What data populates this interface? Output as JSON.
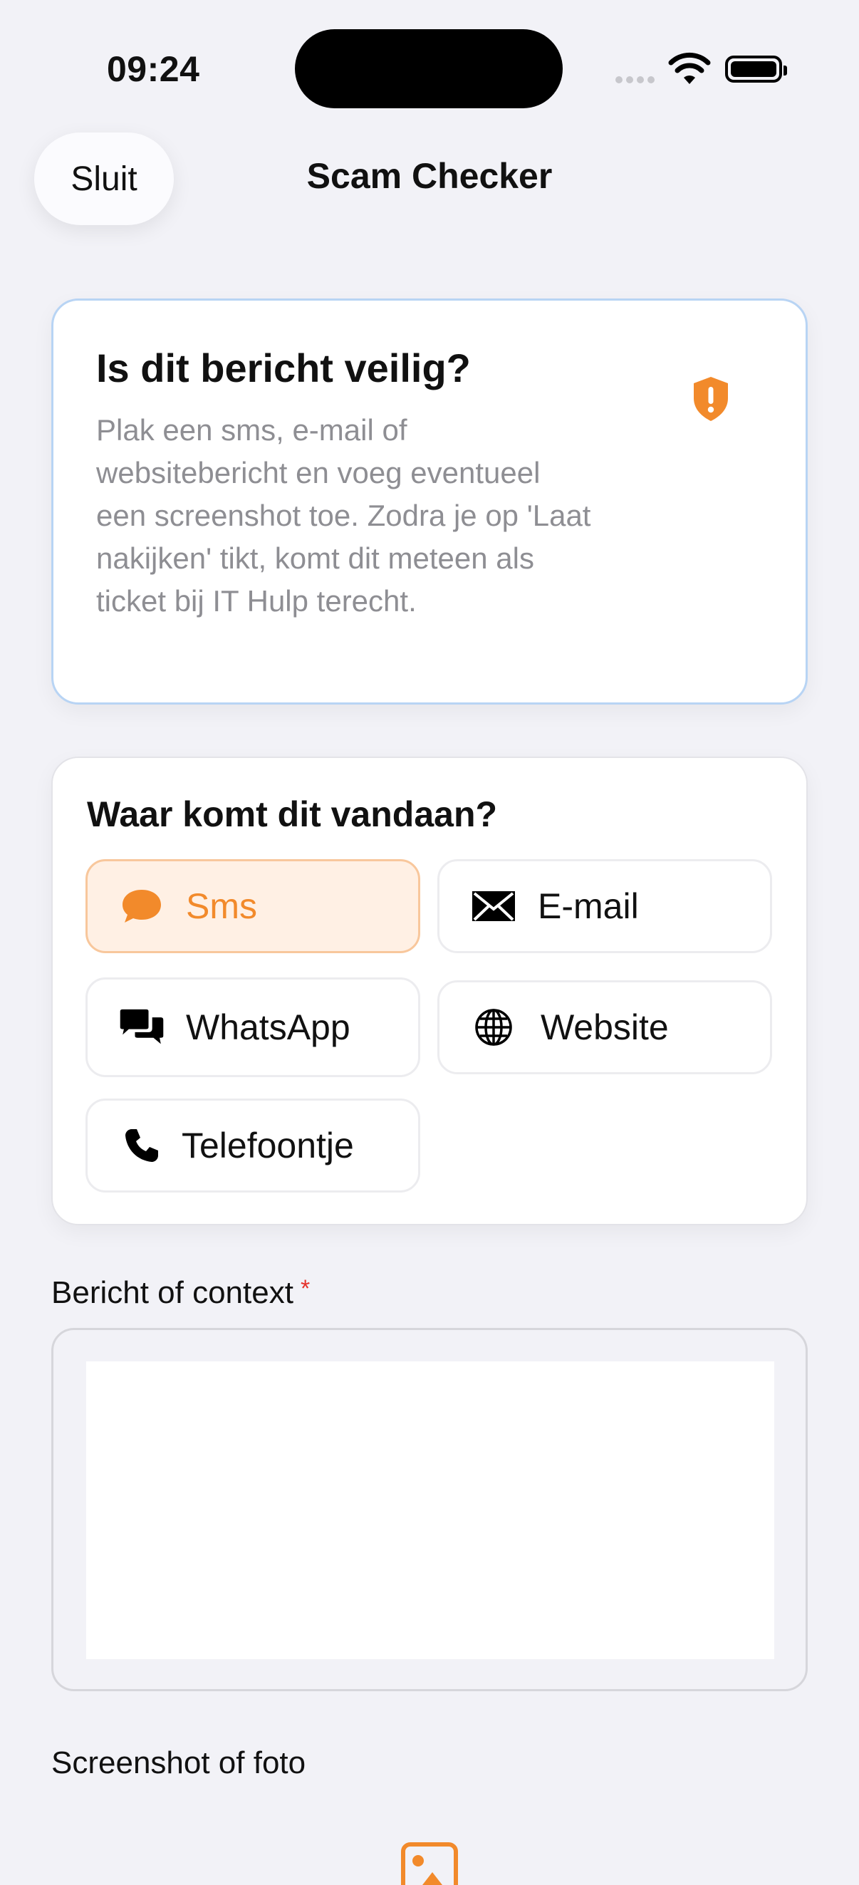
{
  "status_bar": {
    "time": "09:24"
  },
  "nav": {
    "close_label": "Sluit",
    "title": "Scam Checker"
  },
  "hero": {
    "title": "Is dit bericht veilig?",
    "description": "Plak een sms, e-mail of websitebericht en voeg eventueel een screenshot toe. Zodra je op 'Laat nakijken' tikt, komt dit meteen als ticket bij IT Hulp terecht.",
    "icon": "shield-exclamation-icon"
  },
  "source": {
    "title": "Waar komt dit vandaan?",
    "selected": "Sms",
    "options": [
      {
        "label": "Sms",
        "icon": "chat-bubble-icon"
      },
      {
        "label": "E-mail",
        "icon": "envelope-icon"
      },
      {
        "label": "WhatsApp",
        "icon": "chat-bubbles-icon"
      },
      {
        "label": "Website",
        "icon": "globe-icon"
      },
      {
        "label": "Telefoontje",
        "icon": "phone-icon"
      }
    ]
  },
  "message": {
    "label": "Bericht of context",
    "required_mark": "*",
    "value": ""
  },
  "screenshot": {
    "label": "Screenshot of foto",
    "icon": "photo-icon"
  },
  "colors": {
    "accent": "#F28A2B",
    "hero_border": "#B8D4F4",
    "required": "#E5322B",
    "background": "#F2F2F7"
  }
}
